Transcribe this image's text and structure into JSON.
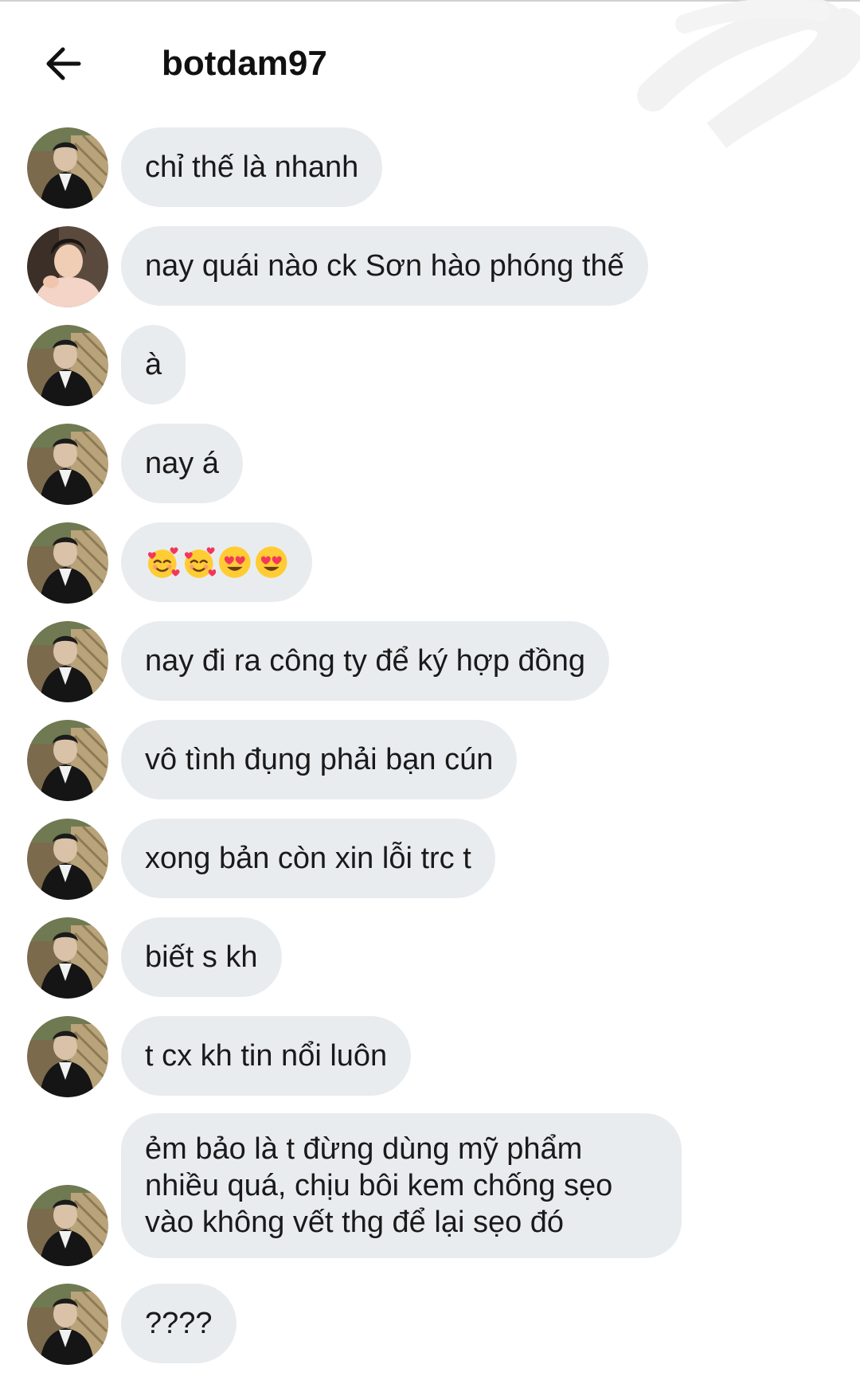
{
  "header": {
    "title": "botdam97",
    "back_icon": "arrow-left-icon"
  },
  "messages": [
    {
      "text": "chỉ thế là nhanh",
      "avatar": "avatar-botdam97"
    },
    {
      "text": "nay quái nào ck Sơn hào phóng thế",
      "avatar": "avatar-other-user"
    },
    {
      "text": "à",
      "avatar": "avatar-botdam97"
    },
    {
      "text": "nay á",
      "avatar": "avatar-botdam97"
    },
    {
      "text": "🥰🥰😍😍",
      "avatar": "avatar-botdam97",
      "emoji": [
        "smiling-face-with-hearts-icon",
        "smiling-face-with-hearts-icon",
        "heart-eyes-icon",
        "heart-eyes-icon"
      ]
    },
    {
      "text": "nay đi ra công ty để ký hợp đồng",
      "avatar": "avatar-botdam97"
    },
    {
      "text": "vô tình đụng phải bạn cún",
      "avatar": "avatar-botdam97"
    },
    {
      "text": "xong bản còn xin lỗi trc t",
      "avatar": "avatar-botdam97"
    },
    {
      "text": "biết s kh",
      "avatar": "avatar-botdam97"
    },
    {
      "text": "t cx kh tin nổi luôn",
      "avatar": "avatar-botdam97"
    },
    {
      "lines": [
        "ẻm bảo là t đừng dùng mỹ phẩm",
        "nhiều quá, chịu bôi kem chống sẹo",
        "vào không vết thg để lại sẹo đó"
      ],
      "avatar": "avatar-botdam97"
    },
    {
      "text": "????",
      "avatar": "avatar-botdam97"
    }
  ],
  "colors": {
    "bubble": "#e9ecef",
    "text": "#1a1a1a",
    "background": "#ffffff"
  }
}
